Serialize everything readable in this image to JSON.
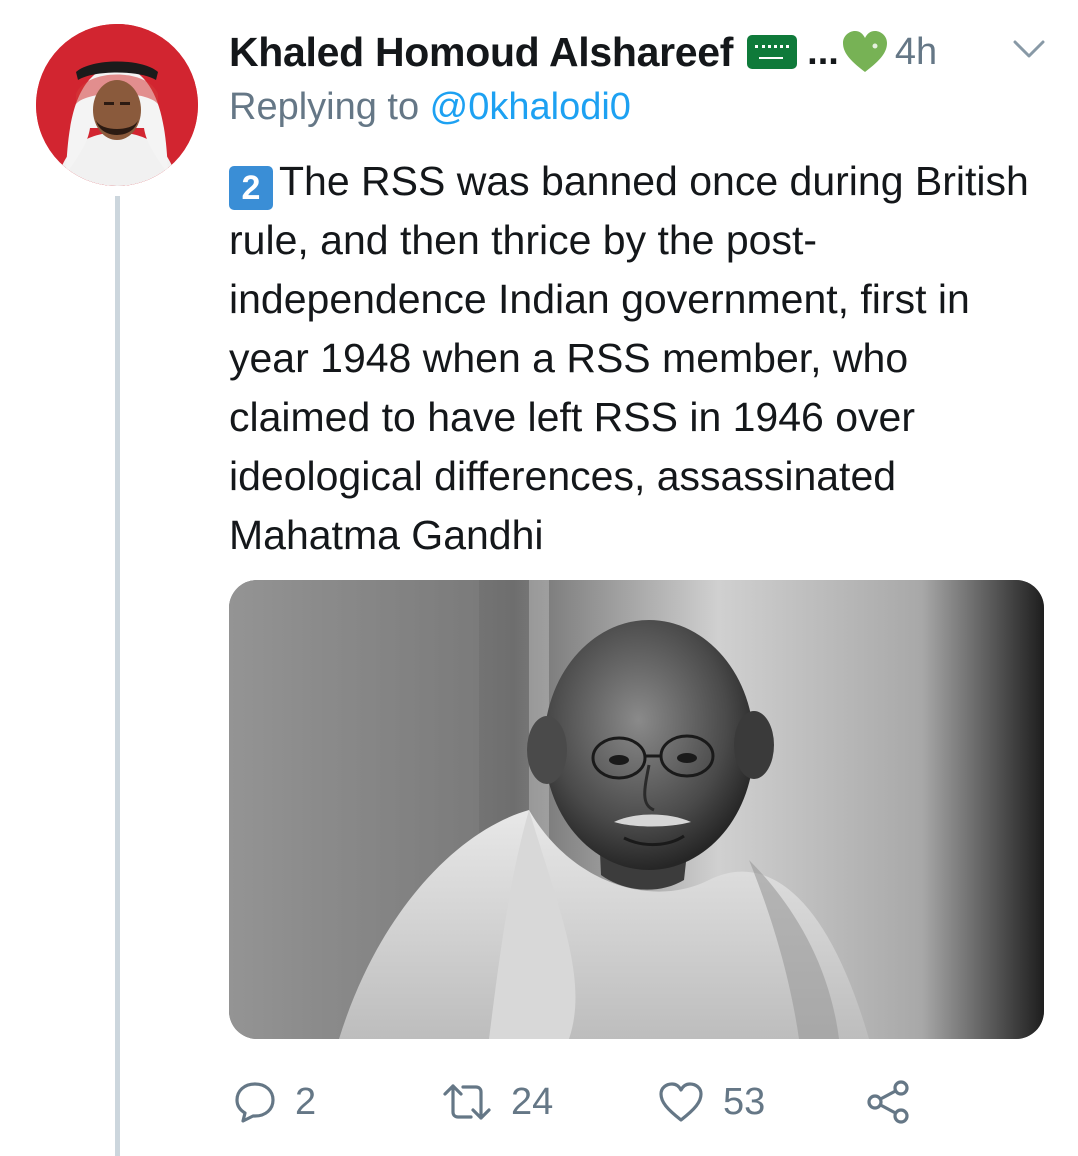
{
  "author": {
    "name": "Khaled Homoud Alshareef",
    "ellipsis": "...",
    "time": "4h"
  },
  "reply": {
    "prefix": "Replying to ",
    "mention": "@0khalodi0"
  },
  "tweet": {
    "badge": "2",
    "text": "The RSS was banned once during British rule, and then thrice by the post-independence Indian government, first in year 1948 when a RSS member, who claimed to have left RSS in 1946 over ideological differences, assassinated Mahatma Gandhi"
  },
  "actions": {
    "replies": "2",
    "retweets": "24",
    "likes": "53"
  },
  "icons": {
    "flag": "saudi-flag-icon",
    "heart_badge": "green-heart-icon",
    "chevron": "chevron-down-icon",
    "reply": "reply-icon",
    "retweet": "retweet-icon",
    "like": "heart-icon",
    "share": "share-icon"
  },
  "colors": {
    "text": "#14171a",
    "secondary": "#657786",
    "link": "#1da1f2",
    "badge": "#3a8ed6",
    "thread_line": "#ccd6dd",
    "green_heart": "#77b255",
    "flag_green": "#0f7a3a"
  }
}
